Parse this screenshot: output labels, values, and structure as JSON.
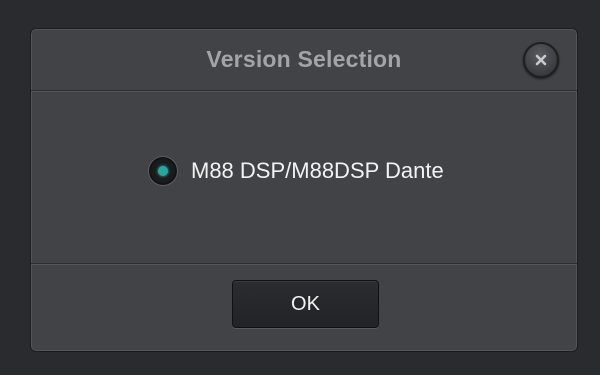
{
  "dialog": {
    "title": "Version Selection",
    "close_icon": "close-icon",
    "options": [
      {
        "label": "M88 DSP/M88DSP Dante",
        "selected": true
      }
    ],
    "ok_label": "OK"
  },
  "colors": {
    "backdrop": "#2a2b2e",
    "dialog_bg": "#424347",
    "title_text": "#a3a4a8",
    "radio_selected": "#2aa69f",
    "text": "#f2f2f2"
  }
}
